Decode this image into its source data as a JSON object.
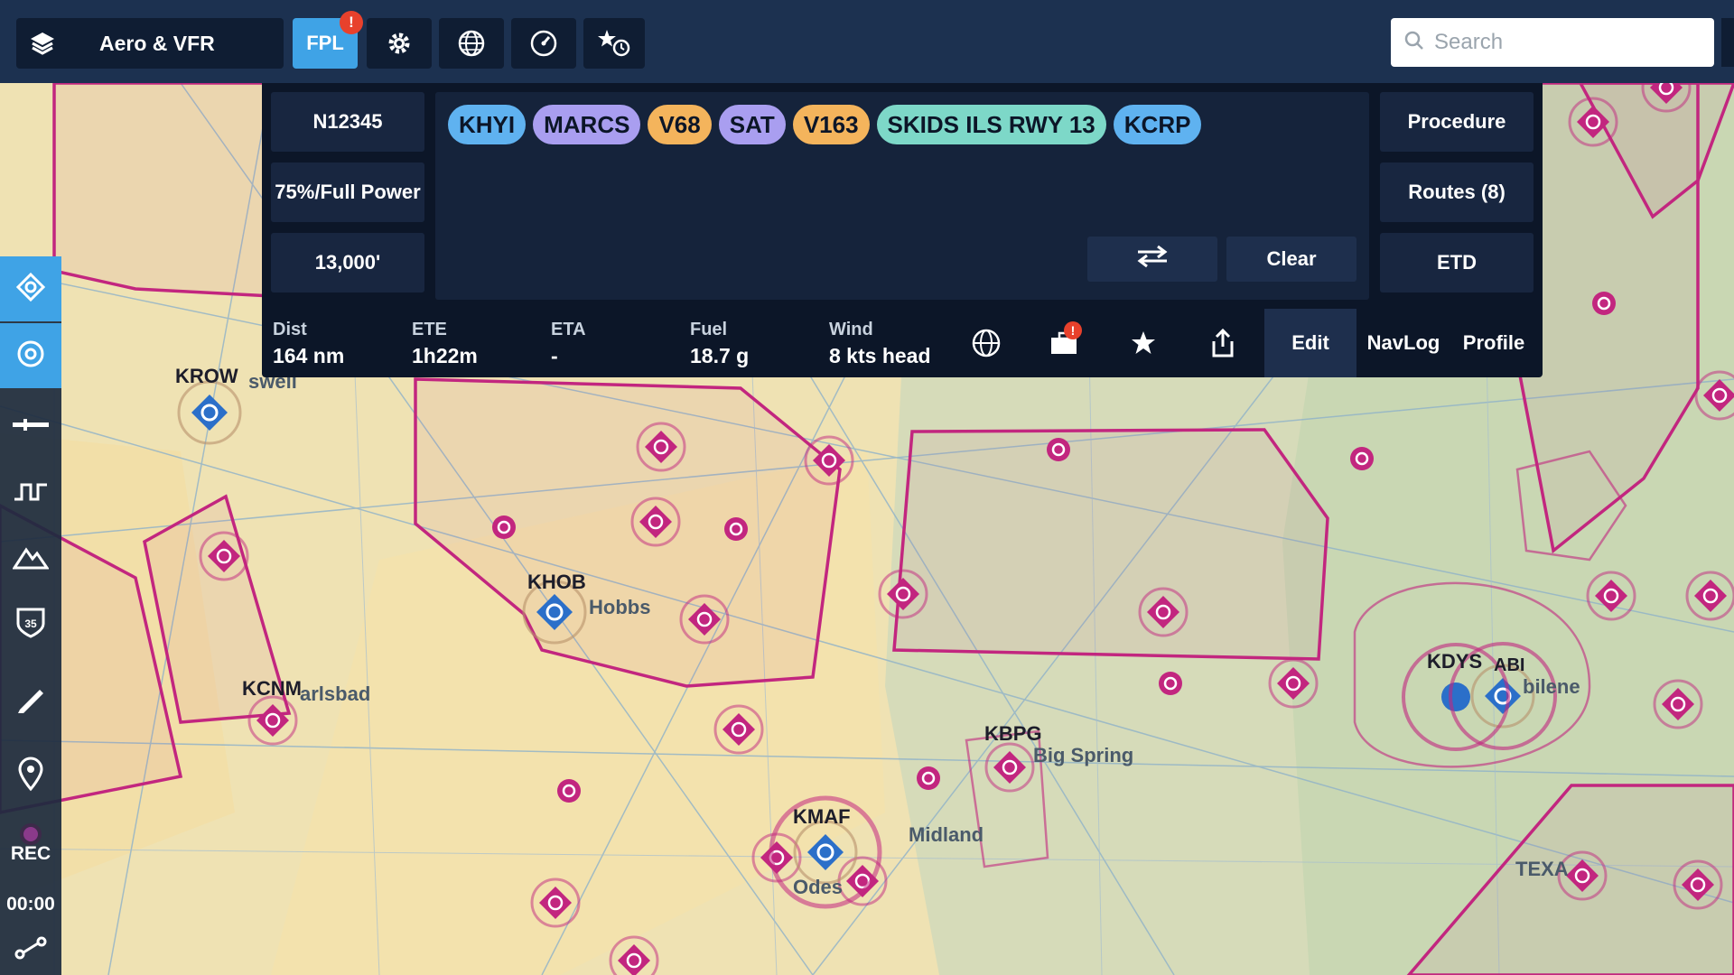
{
  "topbar": {
    "layers_label": "Aero & VFR",
    "fpl_label": "FPL",
    "fpl_badge": "!",
    "search_placeholder": "Search"
  },
  "fpl": {
    "tail": "N12345",
    "power": "75%/Full Power",
    "altitude": "13,000'",
    "route": [
      {
        "label": "KHYI",
        "kind": "airport"
      },
      {
        "label": "MARCS",
        "kind": "fix"
      },
      {
        "label": "V68",
        "kind": "airway"
      },
      {
        "label": "SAT",
        "kind": "fix"
      },
      {
        "label": "V163",
        "kind": "airway"
      },
      {
        "label": "SKIDS ILS RWY 13",
        "kind": "proc"
      },
      {
        "label": "KCRP",
        "kind": "airport"
      }
    ],
    "procedure_label": "Procedure",
    "routes_label": "Routes (8)",
    "etd_label": "ETD",
    "clear_label": "Clear",
    "info": {
      "dist_key": "Dist",
      "dist_val": "164 nm",
      "ete_key": "ETE",
      "ete_val": "1h22m",
      "eta_key": "ETA",
      "eta_val": "-",
      "fuel_key": "Fuel",
      "fuel_val": "18.7 g",
      "wind_key": "Wind",
      "wind_val": "8 kts head"
    },
    "notif_badge": "!",
    "tabs": {
      "edit": "Edit",
      "navlog": "NavLog",
      "profile": "Profile"
    }
  },
  "left_toolbar": {
    "rec_label": "REC",
    "timer": "00:00"
  },
  "map": {
    "airports": [
      {
        "id": "KROW",
        "city": "swell"
      },
      {
        "id": "KHOB",
        "city": "Hobbs"
      },
      {
        "id": "KCNM",
        "city": "arlsbad"
      },
      {
        "id": "KBPG",
        "city": "Big Spring"
      },
      {
        "id": "KMAF",
        "city": "Midland"
      },
      {
        "id": "KDYS",
        "city": ""
      },
      {
        "id": "ABI",
        "city": "bilene"
      }
    ],
    "odessa": "Odes",
    "texas": "TEXA"
  },
  "colors": {
    "topbar": "#1c3150",
    "accent": "#3fa3e6",
    "panel": "#0c1628",
    "airspace": "#c2267f"
  }
}
